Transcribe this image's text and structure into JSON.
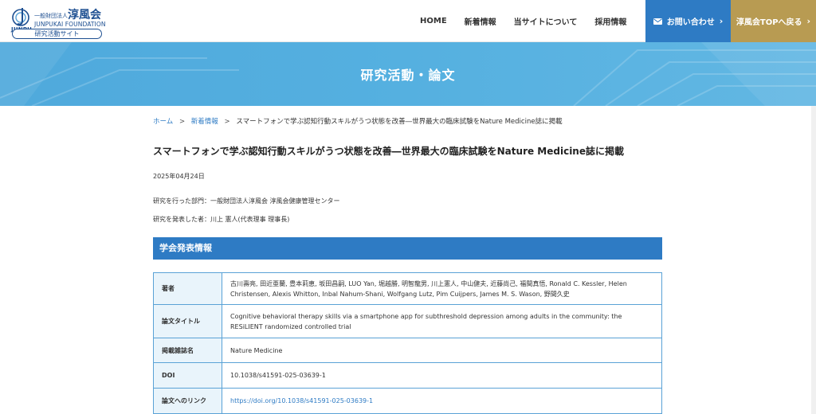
{
  "header": {
    "logo": {
      "mark_text": "JUNPU",
      "small_text": "一般財団法人",
      "big_text": "淳風会",
      "en_text": "JUNPUKAI FOUNDATION",
      "badge_text": "研究活動サイト"
    },
    "nav": [
      {
        "label": "HOME"
      },
      {
        "label": "新着情報"
      },
      {
        "label": "当サイトについて"
      },
      {
        "label": "採用情報"
      }
    ],
    "contact_label": "お問い合わせ",
    "top_label": "淳風会TOPへ戻る",
    "colors": {
      "contact": "#2e7bc4",
      "top": "#b89b52"
    }
  },
  "hero": {
    "title": "研究活動・論文"
  },
  "breadcrumb": {
    "home": "ホーム",
    "news": "新着情報",
    "current": "スマートフォンで学ぶ認知行動スキルがうつ状態を改善―世界最大の臨床試験をNature Medicine誌に掲載",
    "separator": ">"
  },
  "article": {
    "title": "スマートフォンで学ぶ認知行動スキルがうつ状態を改善―世界最大の臨床試験をNature Medicine誌に掲載",
    "date": "2025年04月24日",
    "department": "研究を行った部門：一般財団法人淳風会 淳風会健康管理センター",
    "presenter": "研究を発表した者：川上 憲人(代表理事 理事長)"
  },
  "section": {
    "title": "学会発表情報",
    "rows": [
      {
        "label": "著者",
        "value": "古川壽亮, 田近亜蘭, 豊本莉恵, 坂田昌嗣, LUO Yan, 堀越勝, 明智龍男, 川上憲人, 中山健夫, 近藤尚己, 福間真悟, Ronald C. Kessler, Helen Christensen, Alexis Whitton, Inbal Nahum-Shani, Wolfgang Lutz, Pim Cuijpers, James M. S. Wason, 野間久史"
      },
      {
        "label": "論文タイトル",
        "value": "Cognitive behavioral therapy skills via a smartphone app for subthreshold depression among adults in the community: the RESiLIENT randomized controlled trial"
      },
      {
        "label": "掲載雑誌名",
        "value": "Nature Medicine"
      },
      {
        "label": "DOI",
        "value": "10.1038/s41591-025-03639-1"
      },
      {
        "label": "論文へのリンク",
        "value": "https://doi.org/10.1038/s41591-025-03639-1"
      }
    ]
  }
}
